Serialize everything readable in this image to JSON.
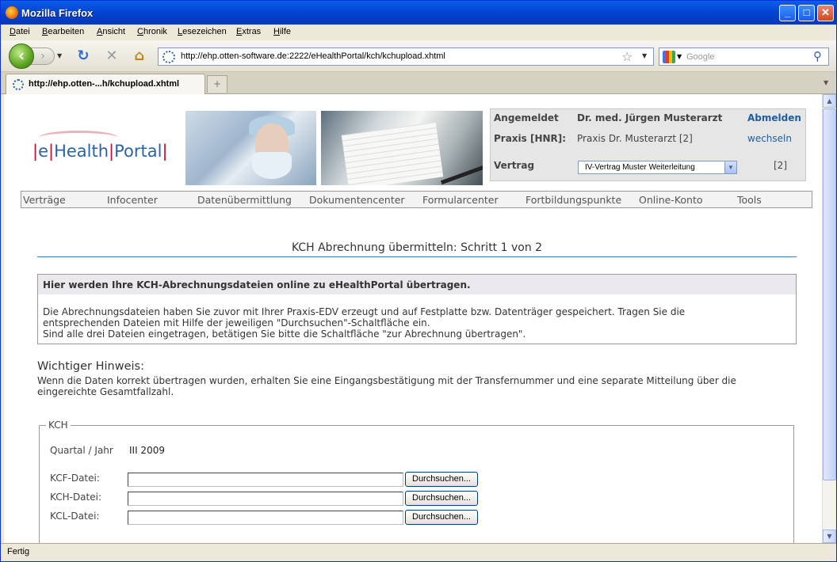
{
  "window": {
    "title": "Mozilla Firefox"
  },
  "menu": [
    "Datei",
    "Bearbeiten",
    "Ansicht",
    "Chronik",
    "Lesezeichen",
    "Extras",
    "Hilfe"
  ],
  "toolbar": {
    "url": "http://ehp.otten-software.de:2222/eHealthPortal/kch/kchupload.xhtml",
    "search_placeholder": "Google"
  },
  "tabs": [
    {
      "label": "http://ehp.otten-...h/kchupload.xhtml"
    },
    {
      "label": "+"
    }
  ],
  "status": "Fertig",
  "page": {
    "logo": {
      "p1": "|",
      "p2": "e",
      "p3": "|",
      "p4": "Health",
      "p5": "|",
      "p6": "Portal",
      "p7": "|"
    },
    "user": {
      "angemeldet_label": "Angemeldet",
      "name": "Dr. med. Jürgen Musterarzt",
      "logout": "Abmelden",
      "praxis_label": "Praxis [HNR]:",
      "praxis_value": "Praxis Dr. Musterarzt [2]",
      "switch": "wechseln",
      "vertrag_label": "Vertrag",
      "vertrag_selected": "IV-Vertrag Muster Weiterleitung",
      "vertrag_count": "[2]"
    },
    "nav": [
      "Verträge",
      "Infocenter",
      "Datenübermittlung",
      "Dokumentencenter",
      "Formularcenter",
      "Fortbildungspunkte",
      "Online-Konto",
      "Tools"
    ],
    "title": "KCH Abrechnung übermitteln: Schritt 1 von 2",
    "info": {
      "heading": "Hier werden Ihre KCH-Abrechnungsdateien online zu eHealthPortal übertragen.",
      "line1": "Die Abrechnungsdateien haben Sie zuvor mit Ihrer Praxis-EDV erzeugt und auf Festplatte bzw. Datenträger gespeichert. Tragen Sie die",
      "line2": "entsprechenden Dateien mit Hilfe der jeweiligen \"Durchsuchen\"-Schaltfläche ein.",
      "line3": "Sind alle drei Dateien eingetragen, betätigen Sie bitte die Schaltfläche \"zur Abrechnung übertragen\"."
    },
    "hinweis": {
      "heading": "Wichtiger Hinweis:",
      "text": "Wenn die Daten korrekt übertragen wurden, erhalten Sie eine Eingangsbestätigung mit der Transfernummer und eine separate Mitteilung über die eingereichte Gesamtfallzahl."
    },
    "form": {
      "legend": "KCH",
      "quartal_label": "Quartal / Jahr",
      "quartal_value": "III 2009",
      "kcf_label": "KCF-Datei:",
      "kch_label": "KCH-Datei:",
      "kcl_label": "KCL-Datei:",
      "browse_label": "Durchsuchen..."
    }
  }
}
